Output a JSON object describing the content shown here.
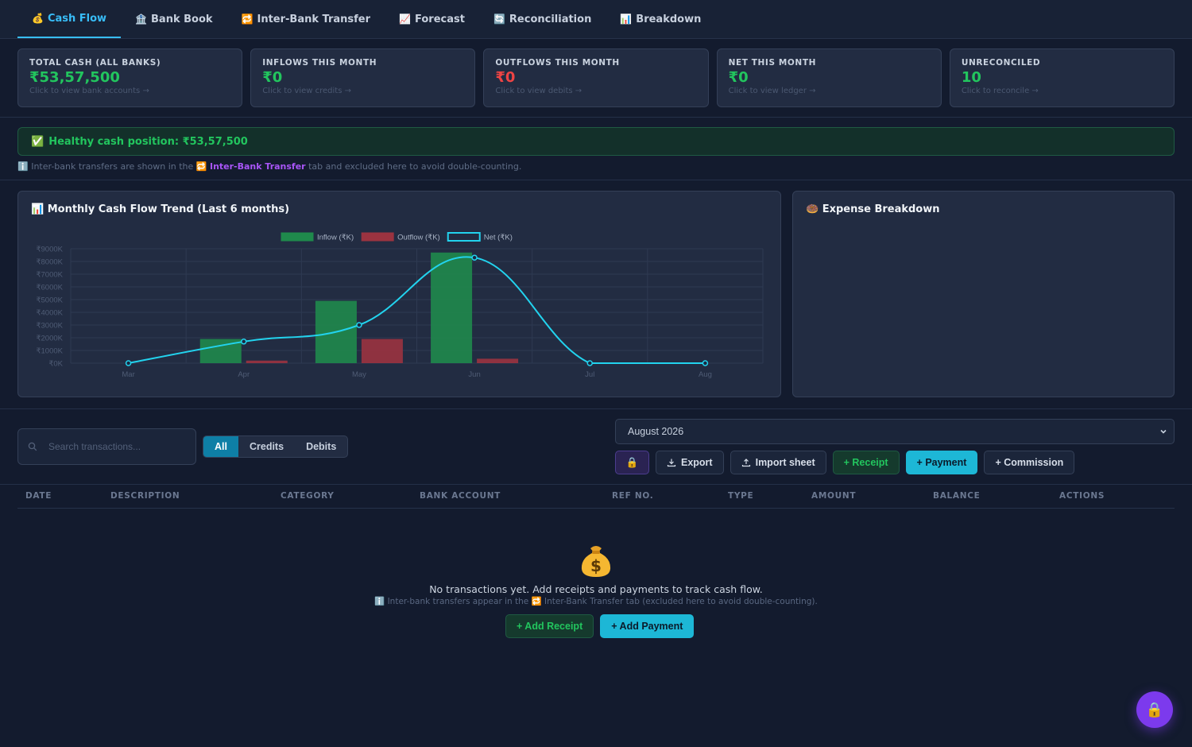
{
  "tabs": [
    {
      "icon": "💰",
      "label": "Cash Flow",
      "active": true
    },
    {
      "icon": "🏦",
      "label": "Bank Book"
    },
    {
      "icon": "🔁",
      "label": "Inter-Bank Transfer"
    },
    {
      "icon": "📈",
      "label": "Forecast"
    },
    {
      "icon": "🔄",
      "label": "Reconciliation"
    },
    {
      "icon": "📊",
      "label": "Breakdown"
    }
  ],
  "kpis": [
    {
      "label": "Total Cash (All Banks)",
      "value": "₹53,57,500",
      "hint": "Click to view bank accounts →",
      "color": "#22c55e"
    },
    {
      "label": "Inflows This Month",
      "value": "₹0",
      "hint": "Click to view credits →",
      "color": "#22c55e"
    },
    {
      "label": "Outflows This Month",
      "value": "₹0",
      "hint": "Click to view debits →",
      "color": "#ef4444"
    },
    {
      "label": "Net This Month",
      "value": "₹0",
      "hint": "Click to view ledger →",
      "color": "#22c55e"
    },
    {
      "label": "Unreconciled",
      "value": "10",
      "hint": "Click to reconcile →",
      "color": "#22c55e"
    }
  ],
  "health": {
    "icon": "✅",
    "text": "Healthy cash position: ₹53,57,500"
  },
  "note": {
    "icon": "ℹ️",
    "prefix": "Inter-bank transfers are shown in the",
    "link_icon": "🔁",
    "link": "Inter-Bank Transfer",
    "suffix": "tab and excluded here to avoid double-counting."
  },
  "trend_panel": {
    "icon": "📊",
    "title": "Monthly Cash Flow Trend (Last 6 months)"
  },
  "expense_panel": {
    "icon": "🍩",
    "title": "Expense Breakdown"
  },
  "chart_data": {
    "type": "bar",
    "categories": [
      "Mar",
      "Apr",
      "May",
      "Jun",
      "Jul",
      "Aug"
    ],
    "series": [
      {
        "name": "Inflow (₹K)",
        "type": "bar",
        "color": "#1f8a4c",
        "values": [
          0,
          1900,
          4900,
          8700,
          0,
          0
        ]
      },
      {
        "name": "Outflow (₹K)",
        "type": "bar",
        "color": "#9b3340",
        "values": [
          0,
          200,
          1900,
          350,
          0,
          0
        ]
      },
      {
        "name": "Net (₹K)",
        "type": "line",
        "color": "#22d3ee",
        "values": [
          0,
          1700,
          3000,
          8300,
          0,
          0
        ]
      }
    ],
    "yticks": [
      "₹0K",
      "₹1000K",
      "₹2000K",
      "₹3000K",
      "₹4000K",
      "₹5000K",
      "₹6000K",
      "₹7000K",
      "₹8000K",
      "₹9000K"
    ],
    "ylim": [
      0,
      9000
    ],
    "legend": "top-center",
    "grid": true
  },
  "toolbar": {
    "search_placeholder": "Search transactions...",
    "filters": [
      {
        "label": "All",
        "active": true
      },
      {
        "label": "Credits"
      },
      {
        "label": "Debits"
      }
    ],
    "month": "August 2026",
    "lock_icon": "🔒",
    "export": "Export",
    "import": "Import sheet",
    "receipt": "+ Receipt",
    "payment": "+ Payment",
    "commission": "+ Commission"
  },
  "table": {
    "columns": [
      "Date",
      "Description",
      "Category",
      "Bank Account",
      "Ref No.",
      "Type",
      "Amount",
      "Balance",
      "Actions"
    ]
  },
  "empty": {
    "icon": "💰",
    "message": "No transactions yet. Add receipts and payments to track cash flow.",
    "sub": "ℹ️ Inter-bank transfers appear in the 🔁 Inter-Bank Transfer tab (excluded here to avoid double-counting).",
    "add_receipt": "+ Add Receipt",
    "add_payment": "+ Add Payment"
  },
  "fab_icon": "🔒"
}
